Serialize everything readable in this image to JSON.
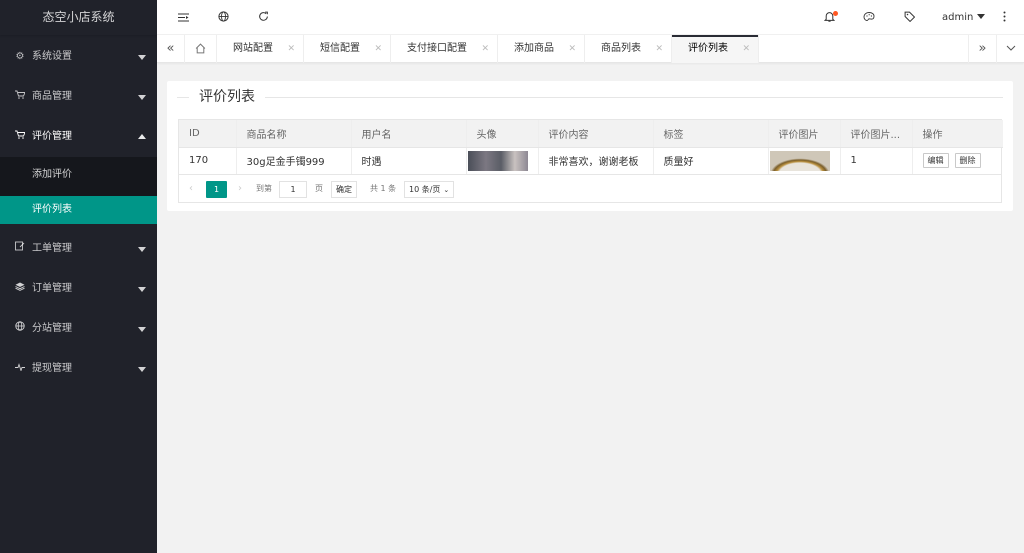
{
  "app": {
    "title": "态空小店系统"
  },
  "sidebar": {
    "items": [
      {
        "label": "系统设置",
        "icon": "gear-icon"
      },
      {
        "label": "商品管理",
        "icon": "cart-icon"
      },
      {
        "label": "评价管理",
        "icon": "cart-icon"
      },
      {
        "label": "工单管理",
        "icon": "edit-icon"
      },
      {
        "label": "订单管理",
        "icon": "layers-icon"
      },
      {
        "label": "分站管理",
        "icon": "globe-icon"
      },
      {
        "label": "提现管理",
        "icon": "pulse-icon"
      }
    ],
    "sub_items": [
      {
        "label": "添加评价"
      },
      {
        "label": "评价列表"
      }
    ]
  },
  "header": {
    "user": "admin",
    "notification_dot_color": "#ff5722"
  },
  "tabs": [
    {
      "label": "网站配置"
    },
    {
      "label": "短信配置"
    },
    {
      "label": "支付接口配置"
    },
    {
      "label": "添加商品"
    },
    {
      "label": "商品列表"
    },
    {
      "label": "评价列表"
    }
  ],
  "main": {
    "title": "评价列表",
    "table": {
      "columns": [
        "ID",
        "商品名称",
        "用户名",
        "头像",
        "评价内容",
        "标签",
        "评价图片",
        "评价图片...",
        "操作"
      ],
      "rows": [
        {
          "id": "170",
          "product": "30g足金手镯999",
          "username": "时遇",
          "content": "非常喜欢，谢谢老板",
          "tag": "质量好",
          "image_count": "1",
          "edit": "编辑",
          "delete": "删除"
        }
      ]
    },
    "pager": {
      "current": "1",
      "goto": "到第",
      "page_input": "1",
      "page_unit": "页",
      "confirm": "确定",
      "total": "共 1 条",
      "per_page": "10 条/页"
    }
  },
  "colors": {
    "accent": "#009688",
    "sidebar_bg": "#20222a"
  }
}
